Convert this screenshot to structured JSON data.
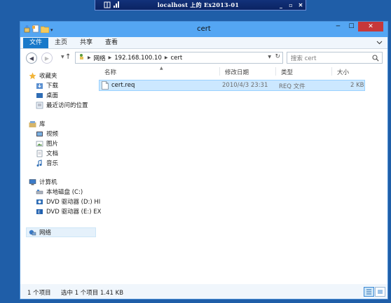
{
  "rdp": {
    "title": "localhost 上的 Ex2013-01",
    "buttons": [
      "_",
      "▫",
      "✕"
    ]
  },
  "window": {
    "title": "cert",
    "controls": [
      "─",
      "☐",
      "✕"
    ]
  },
  "ribbon": {
    "tabs": [
      "文件",
      "主页",
      "共享",
      "查看"
    ]
  },
  "address": {
    "crumbs": [
      "网络",
      "192.168.100.10",
      "cert"
    ]
  },
  "search": {
    "placeholder": "搜索 cert"
  },
  "nav": {
    "favorites": {
      "label": "收藏夹",
      "items": [
        "下载",
        "桌面",
        "最近访问的位置"
      ]
    },
    "library": {
      "label": "库",
      "items": [
        "视频",
        "图片",
        "文档",
        "音乐"
      ]
    },
    "computer": {
      "label": "计算机",
      "items": [
        "本地磁盘 (C:)",
        "DVD 驱动器 (D:) HI",
        "DVD 驱动器 (E:) EX"
      ]
    },
    "network": {
      "label": "网络"
    }
  },
  "columns": {
    "name": "名称",
    "date": "修改日期",
    "type": "类型",
    "size": "大小"
  },
  "files": [
    {
      "name": "cert.req",
      "date": "2010/4/3 23:31",
      "type": "REQ 文件",
      "size": "2 KB"
    }
  ],
  "status": {
    "count": "1 个项目",
    "selected": "选中 1 个项目  1.41 KB"
  },
  "colors": {
    "titlebar": "#54a6f3",
    "file_tab": "#1979ca",
    "close": "#c6383a",
    "selection": "#cce8ff"
  }
}
